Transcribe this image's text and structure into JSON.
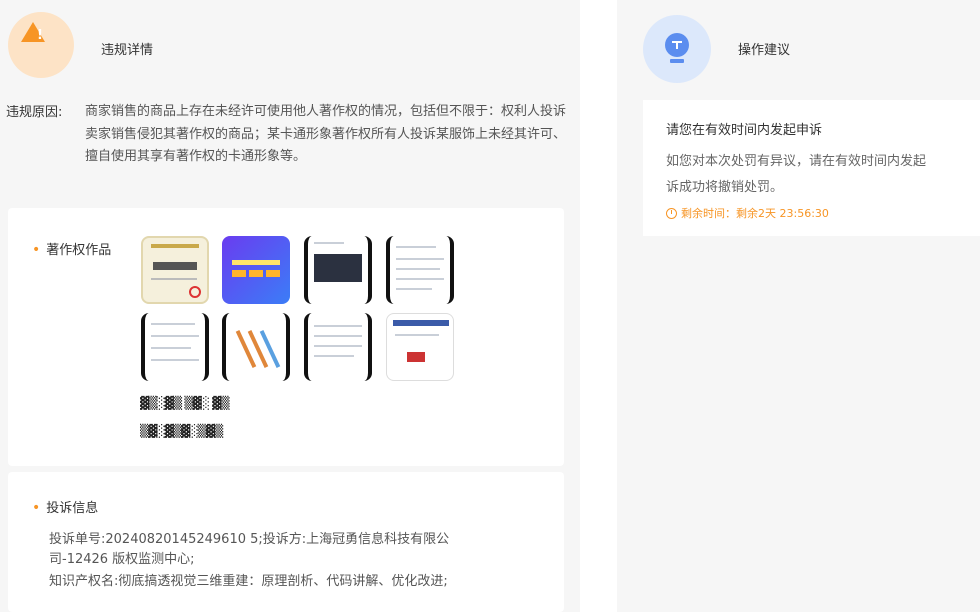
{
  "violation": {
    "title": "违规详情",
    "reason_label": "违规原因:",
    "reason_text": "商家销售的商品上存在未经许可使用他人著作权的情况，包括但不限于：权利人投诉卖家销售侵犯其著作权的商品；某卡通形象著作权所有人投诉某服饰上未经其许可、擅自使用其享有著作权的卡通形象等。"
  },
  "works": {
    "label": "著作权作品",
    "thumbnails": [
      {
        "name": "certificate-thumbnail"
      },
      {
        "name": "course-banner-thumbnail"
      },
      {
        "name": "code-screenshot-thumbnail"
      },
      {
        "name": "document-screenshot-thumbnail"
      },
      {
        "name": "document-page-thumbnail"
      },
      {
        "name": "diagram-thumbnail"
      },
      {
        "name": "text-page-thumbnail"
      },
      {
        "name": "webpage-screenshot-thumbnail"
      }
    ]
  },
  "complaint": {
    "label": "投诉信息",
    "lines": [
      "投诉单号:20240820145249610 5;投诉方:上海冠勇信息科技有限公",
      "司-12426 版权监测中心;",
      "知识产权名:彻底搞透视觉三维重建：原理剖析、代码讲解、优化改进;"
    ]
  },
  "suggestion": {
    "title": "操作建议",
    "card_title": "请您在有效时间内发起申诉",
    "card_body_1": "如您对本次处罚有异议，请在有效时间内发起",
    "card_body_2": "诉成功将撤销处罚。",
    "remaining": "剩余时间：剩余2天 23:56:30"
  },
  "colors": {
    "accent": "#f79525",
    "blue": "#5b8def"
  }
}
